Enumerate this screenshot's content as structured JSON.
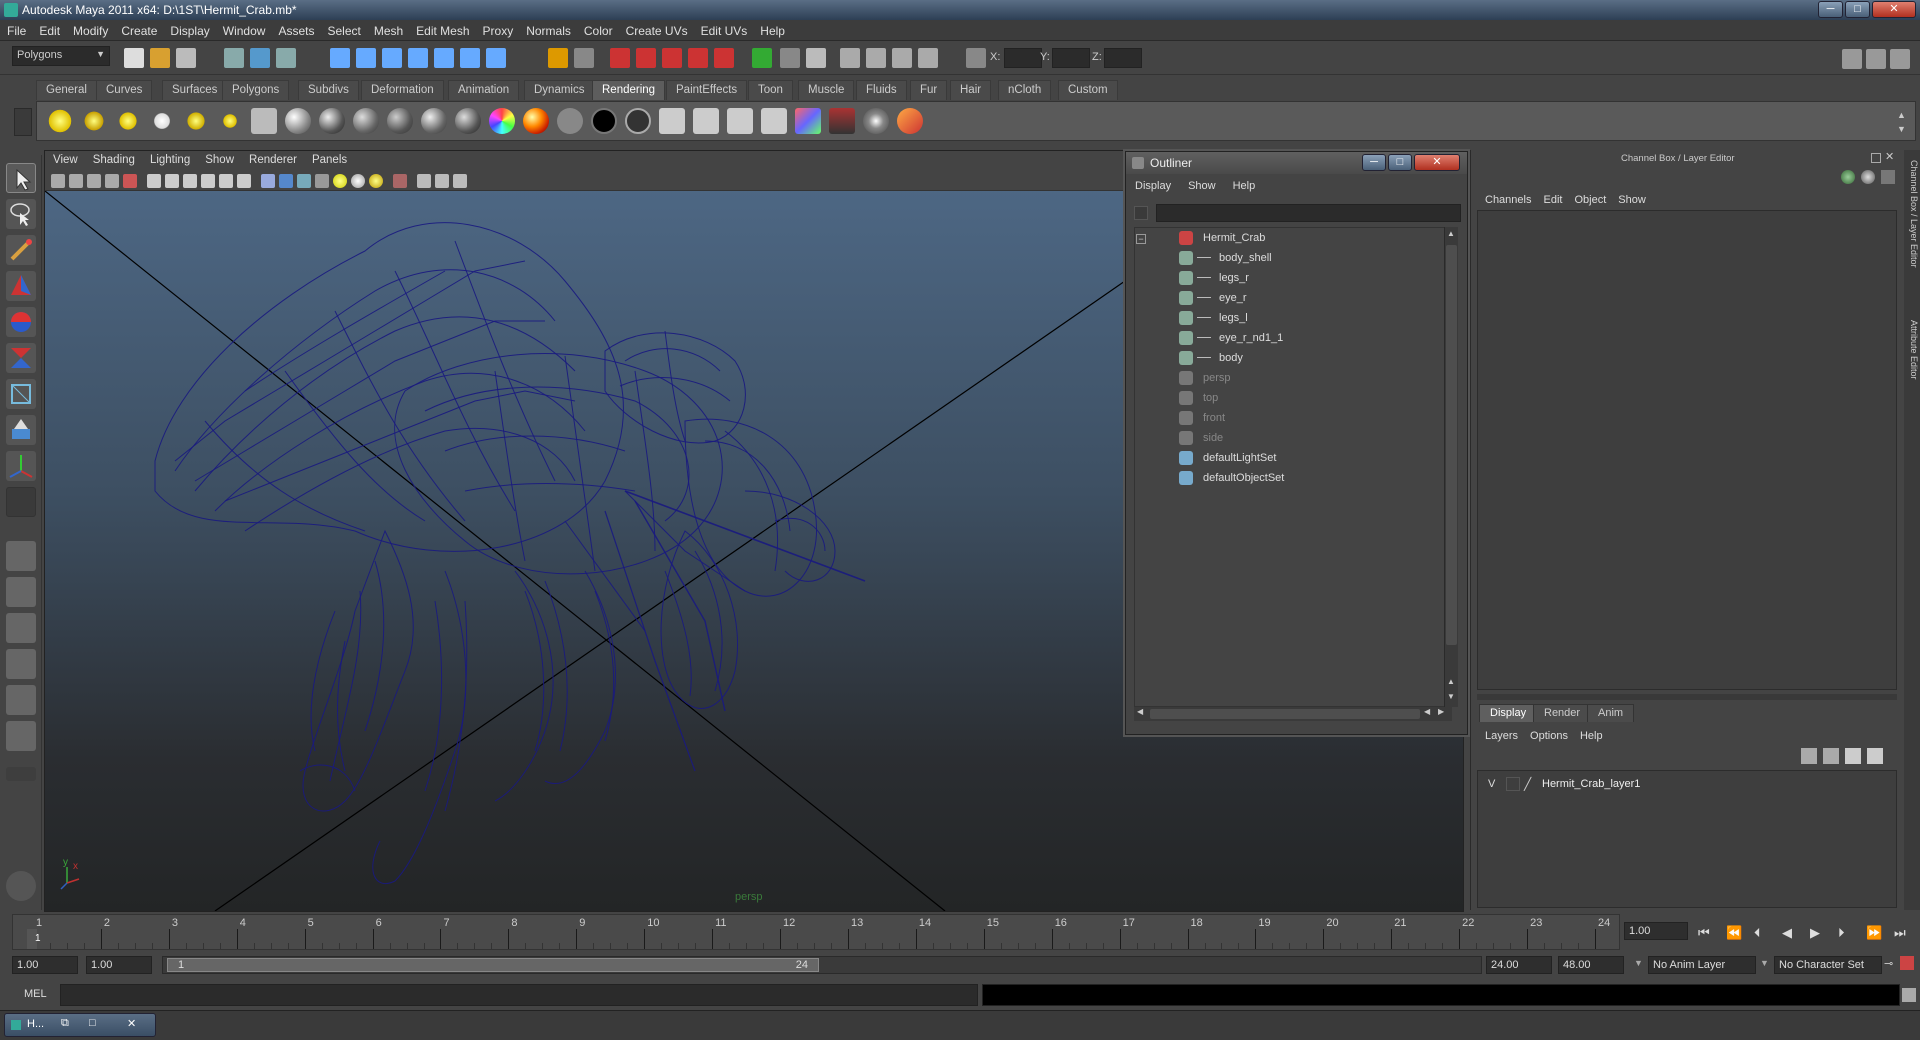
{
  "window": {
    "title": "Autodesk Maya 2011 x64: D:\\1ST\\Hermit_Crab.mb*",
    "min": "─",
    "max": "□",
    "close": "✕"
  },
  "menubar": [
    "File",
    "Edit",
    "Modify",
    "Create",
    "Display",
    "Window",
    "Assets",
    "Select",
    "Mesh",
    "Edit Mesh",
    "Proxy",
    "Normals",
    "Color",
    "Create UVs",
    "Edit UVs",
    "Help"
  ],
  "statusline": {
    "mode": "Polygons",
    "x_label": "X:",
    "y_label": "Y:",
    "z_label": "Z:"
  },
  "shelf": {
    "tabs": [
      "General",
      "Curves",
      "Surfaces",
      "Polygons",
      "Subdivs",
      "Deformation",
      "Animation",
      "Dynamics",
      "Rendering",
      "PaintEffects",
      "Toon",
      "Muscle",
      "Fluids",
      "Fur",
      "Hair",
      "nCloth",
      "Custom"
    ],
    "active_tab": "Rendering"
  },
  "viewport": {
    "menu": [
      "View",
      "Shading",
      "Lighting",
      "Show",
      "Renderer",
      "Panels"
    ],
    "camera_label": "persp"
  },
  "outliner": {
    "title": "Outliner",
    "menu": [
      "Display",
      "Show",
      "Help"
    ],
    "items": [
      {
        "label": "Hermit_Crab",
        "indent": 0,
        "dim": false,
        "icon": "transform-icon"
      },
      {
        "label": "body_shell",
        "indent": 1,
        "dim": false,
        "icon": "mesh-icon"
      },
      {
        "label": "legs_r",
        "indent": 1,
        "dim": false,
        "icon": "mesh-icon"
      },
      {
        "label": "eye_r",
        "indent": 1,
        "dim": false,
        "icon": "mesh-icon"
      },
      {
        "label": "legs_l",
        "indent": 1,
        "dim": false,
        "icon": "mesh-icon"
      },
      {
        "label": "eye_r_nd1_1",
        "indent": 1,
        "dim": false,
        "icon": "mesh-icon"
      },
      {
        "label": "body",
        "indent": 1,
        "dim": false,
        "icon": "mesh-icon"
      },
      {
        "label": "persp",
        "indent": 0,
        "dim": true,
        "icon": "camera-icon"
      },
      {
        "label": "top",
        "indent": 0,
        "dim": true,
        "icon": "camera-icon"
      },
      {
        "label": "front",
        "indent": 0,
        "dim": true,
        "icon": "camera-icon"
      },
      {
        "label": "side",
        "indent": 0,
        "dim": true,
        "icon": "camera-icon"
      },
      {
        "label": "defaultLightSet",
        "indent": 0,
        "dim": false,
        "icon": "set-icon"
      },
      {
        "label": "defaultObjectSet",
        "indent": 0,
        "dim": false,
        "icon": "set-icon"
      }
    ]
  },
  "channelbox": {
    "title": "Channel Box / Layer Editor",
    "menu": [
      "Channels",
      "Edit",
      "Object",
      "Show"
    ],
    "layer_tabs": [
      "Display",
      "Render",
      "Anim"
    ],
    "layer_menu": [
      "Layers",
      "Options",
      "Help"
    ],
    "layer_row": {
      "visible": "V",
      "name": "Hermit_Crab_layer1"
    },
    "side_tabs": [
      "Channel Box / Layer Editor",
      "Attribute Editor"
    ]
  },
  "timeline": {
    "ticks": [
      "1",
      "2",
      "3",
      "4",
      "5",
      "6",
      "7",
      "8",
      "9",
      "10",
      "11",
      "12",
      "13",
      "14",
      "15",
      "16",
      "17",
      "18",
      "19",
      "20",
      "21",
      "22",
      "23",
      "24"
    ],
    "current_frame_marker": "1",
    "current_time": "1.00"
  },
  "range": {
    "start": "1.00",
    "playback_start": "1.00",
    "slider_start": "1",
    "slider_end": "24",
    "playback_end": "24.00",
    "end": "48.00",
    "anim_layer": "No Anim Layer",
    "character_set": "No Character Set"
  },
  "cmdline": {
    "label": "MEL"
  },
  "taskbar": {
    "item": "H..."
  },
  "colors": {
    "wireframe": "#1a1a80",
    "axis_y": "#3aa83a",
    "axis_x": "#c03030"
  }
}
